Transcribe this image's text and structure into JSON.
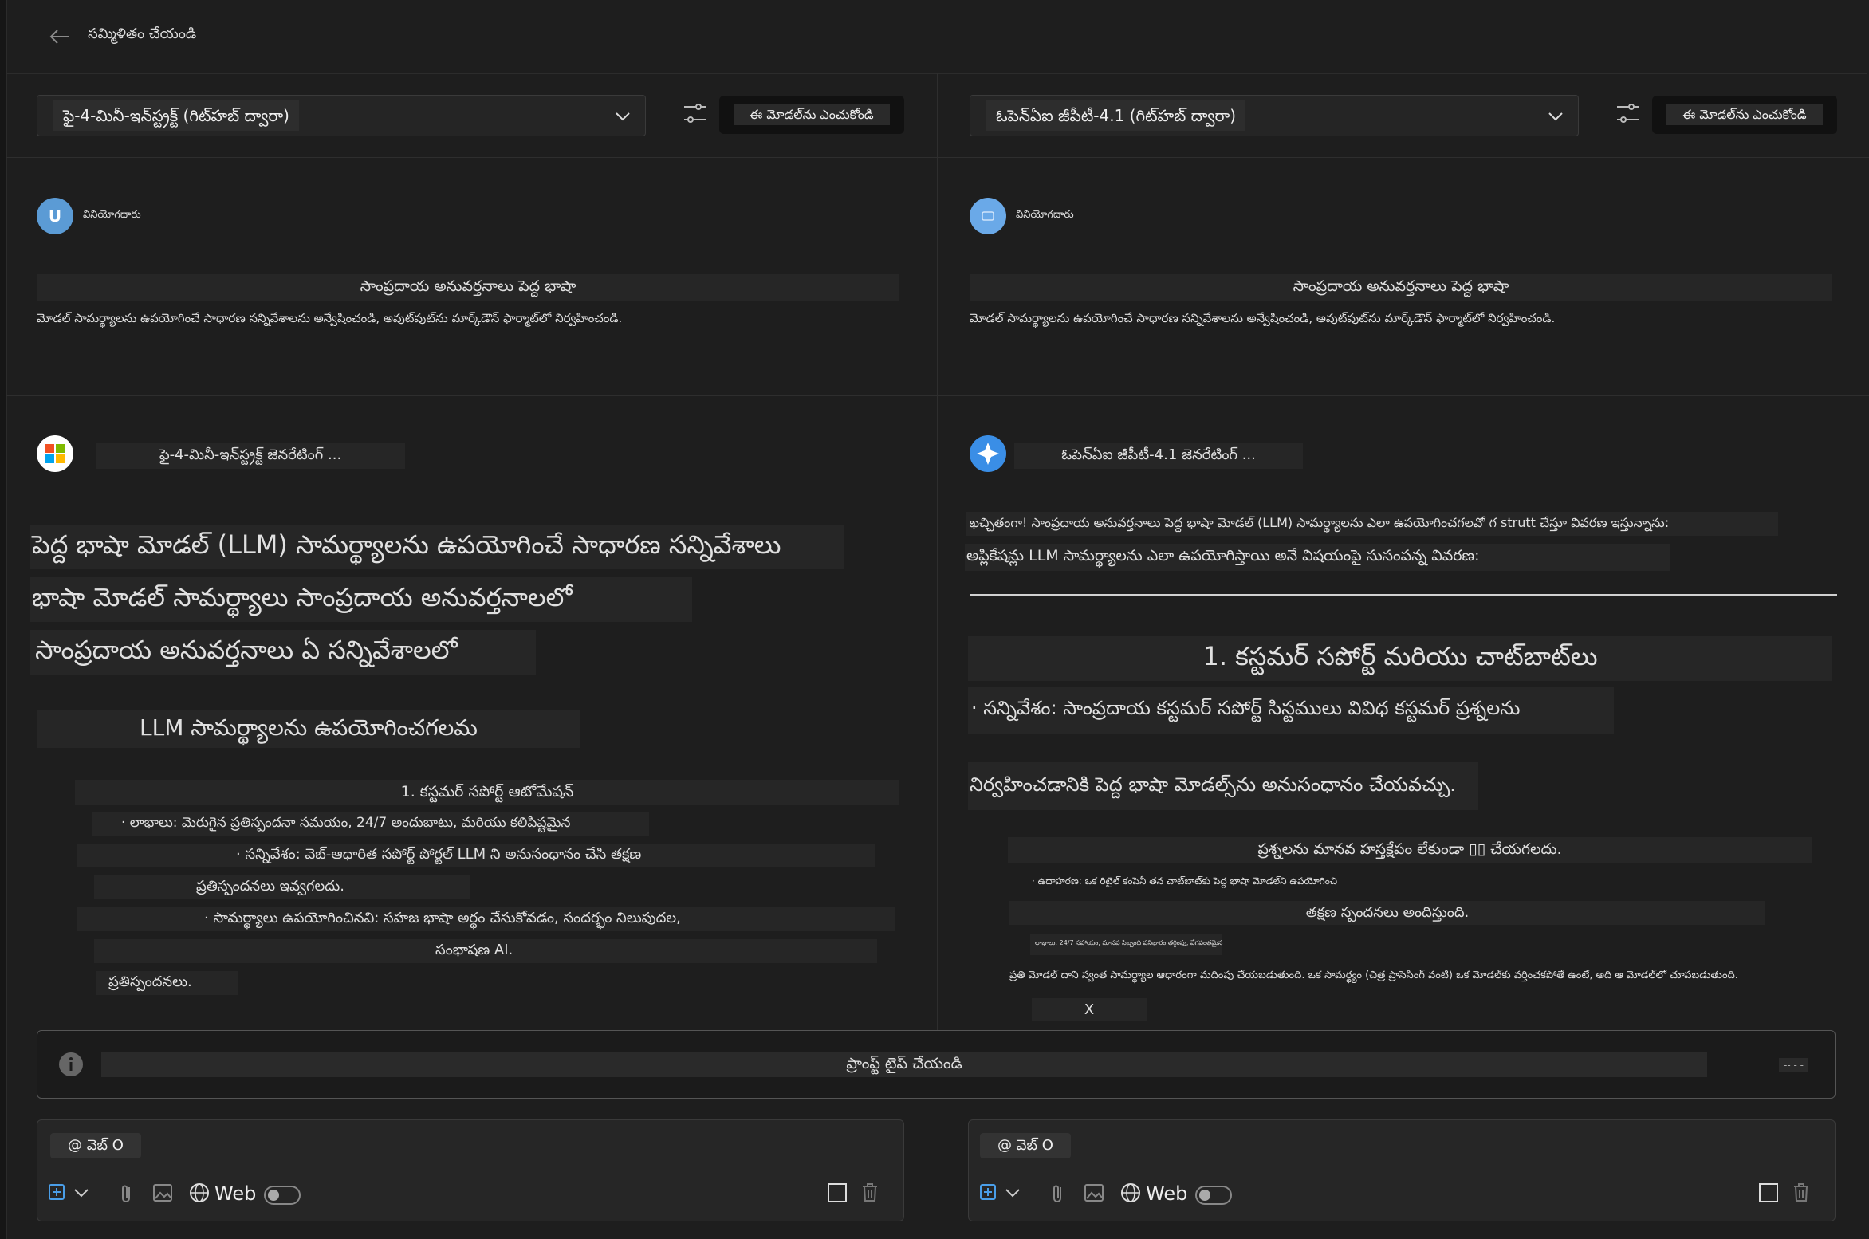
{
  "header": {
    "back_icon": "arrow-left-icon",
    "title": "సమ్మిళితం చేయండి"
  },
  "left_panel": {
    "model_dropdown": "ఫై-4-మినీ-ఇన్‌స్ట్రక్ట్ (గిట్‌హబ్ ద్వారా)",
    "select_model_button": "ఈ మోడల్‌ను ఎంచుకోండి",
    "user_avatar_letter": "U",
    "user_label": "వినియోగదారు",
    "prompt_title": "సాంప్రదాయ అనువర్తనాలు పెద్ద భాషా",
    "prompt_text": "మోడల్ సామర్థ్యాలను ఉపయోగించే సాధారణ సన్నివేశాలను అన్వేషించండి, అవుట్‌పుట్‌ను మార్క్‌డౌన్ ఫార్మాట్‌లో నిర్వహించండి.",
    "assistant_status": "ఫై-4-మినీ-ఇన్‌స్ట్రక్ట్ జెనరేటింగ్ ...",
    "response": {
      "heading_lines": [
        "పెద్ద భాషా మోడల్ (LLM) సామర్థ్యాలను ఉపయోగించే సాధారణ సన్నివేశాలు",
        "భాషా మోడల్ సామర్థ్యాలు సాంప్రదాయ అనువర్తనాలలో",
        "సాంప్రదాయ అనువర్తనాలు ఏ సన్నివేశాలలో"
      ],
      "subheading": "LLM సామర్థ్యాలను ఉపయోగించగలమ",
      "lines": [
        "1. కస్టమర్ సపోర్ట్ ఆటోమేషన్",
        "· లాభాలు: మెరుగైన ప్రతిస్పందనా సమయం, 24/7 అందుబాటు, మరియు కలిపిష్టమైన",
        "· సన్నివేశం: వెబ్-ఆధారిత సపోర్ట్ పోర్టల్ LLM ని అనుసంధానం చేసి తక్షణ",
        "ప్రతిస్పందనలు ఇవ్వగలదు.",
        "· సామర్థ్యాలు ఉపయోగించినవి: సహజ భాషా అర్థం చేసుకోవడం, సందర్భం నిలుపుదల,",
        "సంభాషణ AI.",
        "ప్రతిస్పందనలు."
      ]
    }
  },
  "right_panel": {
    "model_dropdown": "ఓపెన్ఏఐ జీపీటీ-4.1 (గిట్‌హబ్ ద్వారా)",
    "select_model_button": "ఈ మోడల్‌ను ఎంచుకోండి",
    "user_label": "వినియోగదారు",
    "prompt_title": "సాంప్రదాయ అనువర్తనాలు పెద్ద భాషా",
    "prompt_text": "మోడల్ సామర్థ్యాలను ఉపయోగించే సాధారణ సన్నివేశాలను అన్వేషించండి, అవుట్‌పుట్‌ను మార్క్‌డౌన్ ఫార్మాట్‌లో నిర్వహించండి.",
    "assistant_status": "ఓపెన్ఏఐ జీపీటీ-4.1 జెనరేటింగ్ ...",
    "response": {
      "intro1": "ఖచ్చితంగా! సాంప్రదాయ అనువర్తనాలు పెద్ద భాషా మోడల్ (LLM) సామర్థ్యాలను ఎలా ఉపయోగించగలవో గ strutt చేస్తూ వివరణ ఇస్తున్నాను:",
      "intro2": "అప్లికేషన్లు LLM సామర్థ్యాలను ఎలా ఉపయోగిస్తాయి అనే విషయంపై సుసంపన్న వివరణ:",
      "section_title": "1. కస్టమర్ సపోర్ట్ మరియు చాట్‌బాట్‌లు",
      "line1": "· సన్నివేశం: సాంప్రదాయ కస్టమర్ సపోర్ట్ సిస్టములు వివిధ కస్టమర్ ప్రశ్నలను",
      "line2": "నిర్వహించడానికి పెద్ద భాషా మోడల్స్‌ను అనుసంధానం చేయవచ్చు.",
      "line3": "ప్రశ్నలను మానవ హస్తక్షేపం లేకుండా ▯▯ చేయగలదు.",
      "line4": "· ఉదాహరణ: ఒక రిటైల్ కంపెనీ తన చాట్‌బాట్‌కు పెద్ద భాషా మోడల్‌ని ఉపయోగించి",
      "line5": "తక్షణ స్పందనలు అందిస్తుంది.",
      "line6": "లాభాలు: 24/7 సహాయం, మానవ సిబ్బంది పనిభారం తగ్గింపు, వేగవంతమైన",
      "line7": "ప్రతి మోడల్ దాని స్వంత సామర్థ్యాల ఆధారంగా మదింపు చేయబడుతుంది. ఒక సామర్థ్యం (చిత్ర ప్రాసెసింగ్ వంటి) ఒక మోడల్‌కు వర్తించకపోతే ఉంటే, అది ఆ మోడల్‌లో చూపబడుతుంది.",
      "line8": "X"
    }
  },
  "prompt_input": {
    "info_icon": "info-icon",
    "placeholder": "ప్రాంప్ట్ టైప్ చేయండి",
    "right_hint": "-- - -"
  },
  "composers": [
    {
      "chip": "@ వెబ్ O",
      "web_label": "Web"
    },
    {
      "chip": "@ వెబ్ O",
      "web_label": "Web"
    }
  ]
}
